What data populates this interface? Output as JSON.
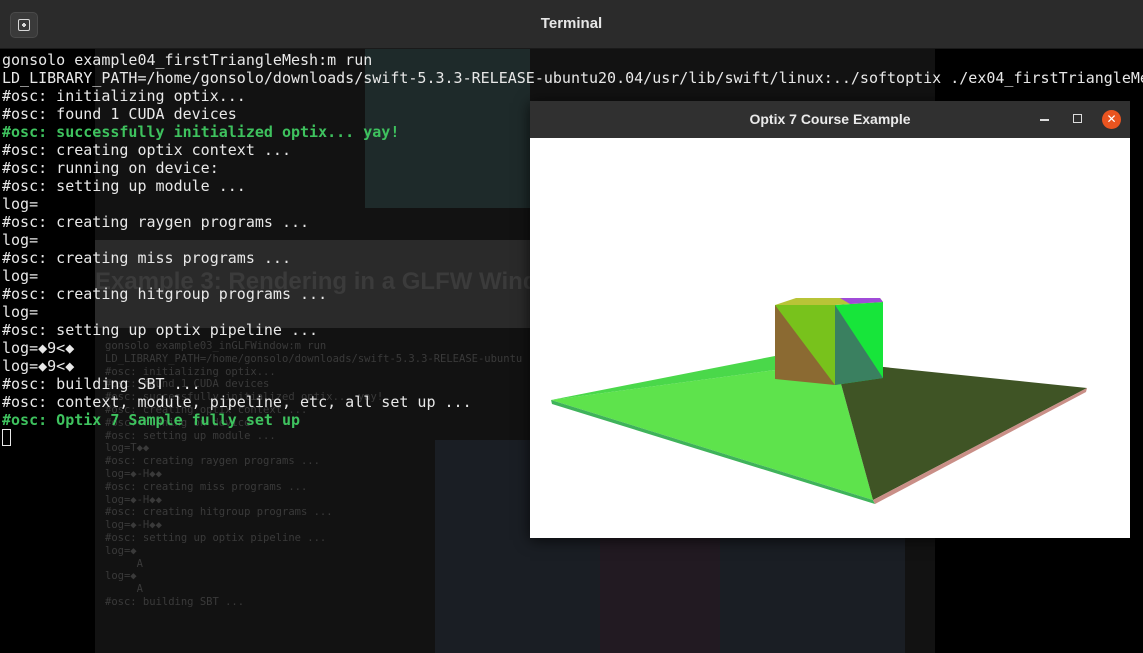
{
  "terminal": {
    "title": "Terminal",
    "lines": [
      {
        "text": "gonsolo example04_firstTriangleMesh:m run",
        "style": "normal"
      },
      {
        "text": "LD_LIBRARY_PATH=/home/gonsolo/downloads/swift-5.3.3-RELEASE-ubuntu20.04/usr/lib/swift/linux:../softoptix ./ex04_firstTriangleMe",
        "style": "normal"
      },
      {
        "text": "#osc: initializing optix...",
        "style": "normal"
      },
      {
        "text": "#osc: found 1 CUDA devices",
        "style": "normal"
      },
      {
        "text": "#osc: successfully initialized optix... yay!",
        "style": "green"
      },
      {
        "text": "#osc: creating optix context ...",
        "style": "normal"
      },
      {
        "text": "#osc: running on device:",
        "style": "normal"
      },
      {
        "text": "#osc: setting up module ...",
        "style": "normal"
      },
      {
        "text": "log=",
        "style": "normal"
      },
      {
        "text": "#osc: creating raygen programs ...",
        "style": "normal"
      },
      {
        "text": "log=",
        "style": "normal"
      },
      {
        "text": "#osc: creating miss programs ...",
        "style": "normal"
      },
      {
        "text": "log=",
        "style": "normal"
      },
      {
        "text": "#osc: creating hitgroup programs ...",
        "style": "normal"
      },
      {
        "text": "log=",
        "style": "normal"
      },
      {
        "text": "#osc: setting up optix pipeline ...",
        "style": "normal"
      },
      {
        "text": "log=◆9<◆",
        "style": "normal"
      },
      {
        "text": "log=◆9<◆",
        "style": "normal"
      },
      {
        "text": "#osc: building SBT ...",
        "style": "normal"
      },
      {
        "text": "#osc: context, module, pipeline, etc, all set up ...",
        "style": "normal"
      },
      {
        "text": "#osc: Optix 7 Sample fully set up",
        "style": "green"
      }
    ]
  },
  "background_page": {
    "heading": "Example 3: Rendering in a GLFW Window",
    "code_lines": [
      "gonsolo example03_inGLFWindow:m run",
      "LD_LIBRARY_PATH=/home/gonsolo/downloads/swift-5.3.3-RELEASE-ubuntu",
      "#osc: initializing optix...",
      "#osc: found 1 CUDA devices",
      "#osc: successfully initialized optix... yay!",
      "#osc: creating optix context ...",
      "#osc: running on device",
      "#osc: setting up module ...",
      "log=T◆◆",
      "#osc: creating raygen programs ...",
      "log=◆-H◆◆",
      "#osc: creating miss programs ...",
      "log=◆-H◆◆",
      "#osc: creating hitgroup programs ...",
      "log=◆-H◆◆",
      "#osc: setting up optix pipeline ...",
      "log=◆",
      "     A",
      "log=◆",
      "     A",
      "#osc: building SBT ..."
    ]
  },
  "optix_window": {
    "title": "Optix 7 Course Example",
    "close_label": "✕"
  },
  "colors": {
    "green_text": "#3ec25e",
    "close_button": "#e95420"
  },
  "icons": {
    "new_tab": "new-tab-icon",
    "minimize": "minimize-icon",
    "maximize": "maximize-icon",
    "close": "close-icon"
  }
}
